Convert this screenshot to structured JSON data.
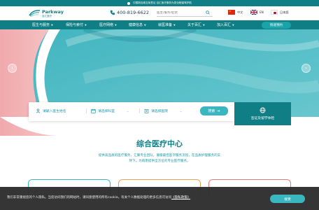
{
  "topbar": {
    "notice": "中国新加坡互免签证 百汇医疗服务为您全程保驾护航"
  },
  "header": {
    "logo_en": "Parkway",
    "logo_cn": "百汇医疗",
    "phone": "400-819-6622",
    "search_placeholder": "医生/服务/症状",
    "languages": [
      {
        "label": "中文"
      },
      {
        "label": "EN"
      },
      {
        "label": "日本語"
      }
    ]
  },
  "nav": {
    "items": [
      "医生与服务",
      "保险与索付",
      "医疗网络",
      "健康信息",
      "就医准备",
      "关于百汇",
      "加入百汇"
    ],
    "cta": "快速预约"
  },
  "search": {
    "doctor_placeholder": "请输入医生姓名",
    "specialty_placeholder": "请选择科室",
    "hospital_placeholder": "请选择医院",
    "button": "搜索",
    "visa_label": "签证及留学体检"
  },
  "section": {
    "title": "综合医疗中心",
    "description_line1": "提供高品质的医疗服务，汇聚专业团队，遵循最佳医学服务流程，在品质护理服务的支",
    "description_line2": "持下，为病患提供全方位的专业医疗服务。"
  },
  "cookie": {
    "text": "我们非常重视您的个人隐私。当您访问我们的网站时，请同意使用的所有cookie。有关个人数据处理的更多信息可访问",
    "link": "《隐私政策》",
    "accept": "接受"
  },
  "colors": {
    "brand": "#0f7e85",
    "accent": "#3ab6c0"
  }
}
